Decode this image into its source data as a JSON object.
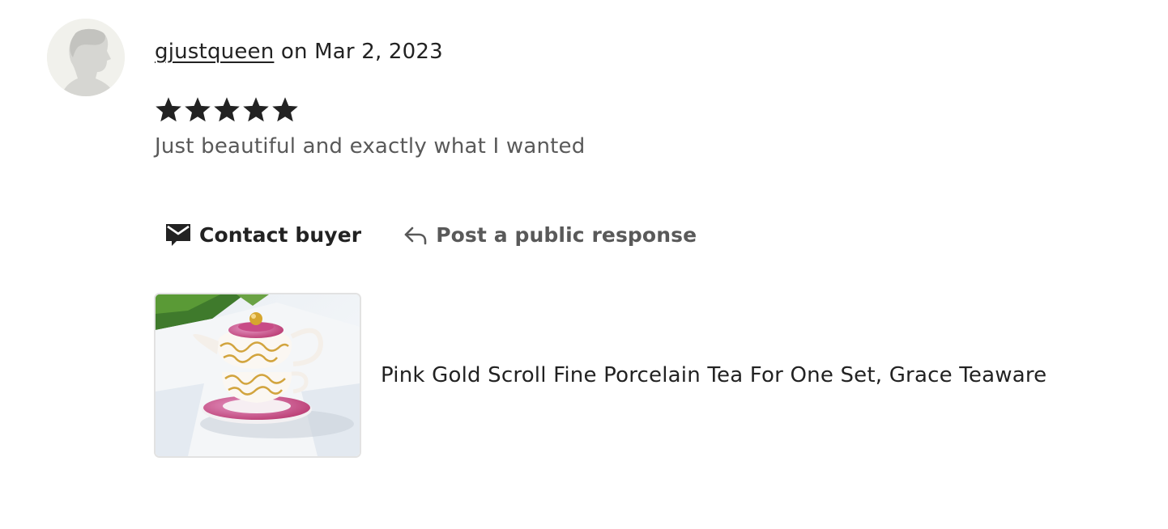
{
  "review": {
    "avatar_icon": "default-user-silhouette",
    "username": "gjustqueen",
    "date_prefix": "on",
    "date": "Mar 2, 2023",
    "rating": 5,
    "rating_max": 5,
    "text": "Just beautiful and exactly what I wanted"
  },
  "actions": {
    "contact_label": "Contact buyer",
    "contact_icon": "envelope-icon",
    "respond_label": "Post a public response",
    "respond_icon": "reply-arrow-icon"
  },
  "listing": {
    "title": "Pink Gold Scroll Fine Porcelain Tea For One Set, Grace Teaware",
    "image_subject": "pink and gold scroll porcelain teapot on saucer"
  },
  "colors": {
    "text_primary": "#222222",
    "text_secondary": "#595959",
    "avatar_bg": "#f1f1ec",
    "star": "#222222"
  }
}
